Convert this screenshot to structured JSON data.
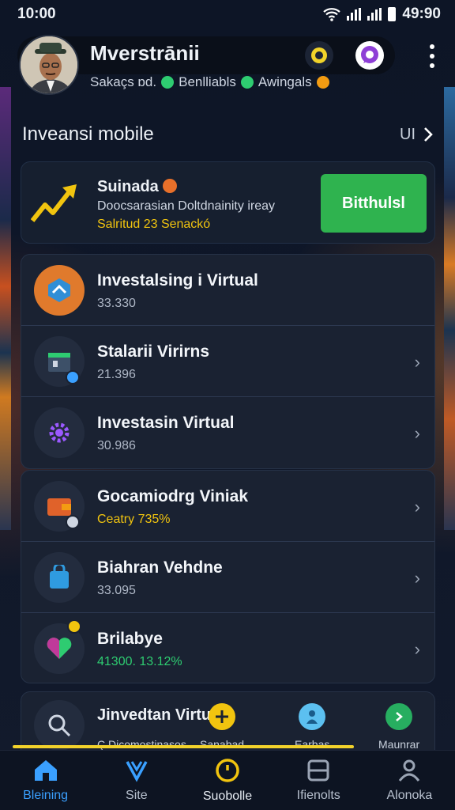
{
  "status": {
    "time": "10:00",
    "battery_time": "49:90"
  },
  "header": {
    "name": "Mverstrānii",
    "subtitle": [
      "Sakaçs ɒd.",
      "Benlliabls",
      "Awingals"
    ]
  },
  "section": {
    "title": "Inveansi mobile",
    "more": "UI"
  },
  "promo": {
    "title": "Suinada",
    "desc": "Doocsarasian Doltdnainity ireay",
    "note": "Salritud 23 Senackó",
    "button": "Bitthulsl"
  },
  "items": [
    {
      "title": "Investalsing i Virtual",
      "value": "33.330"
    },
    {
      "title": "Stalarii Virirns",
      "value": "21.396"
    },
    {
      "title": "Investasin Virtual",
      "value": "30.986"
    },
    {
      "title": "Gocamiodrg Viniak",
      "value": "Ceatry 735%"
    },
    {
      "title": "Biahran Vehdne",
      "value": "33.095"
    },
    {
      "title": "Brilabye",
      "value": "41300. 13.12%"
    }
  ],
  "partial": {
    "title": "Jinvedtan Virtu",
    "note": "Ç Dicomostinasos",
    "icons": [
      "Sanabad",
      "Earbas",
      "Maunrar"
    ]
  },
  "nav": [
    {
      "label": "Bleining"
    },
    {
      "label": "Site"
    },
    {
      "label": "Suobolle"
    },
    {
      "label": "Ifienolts"
    },
    {
      "label": "Alonoka"
    }
  ],
  "colors": {
    "accent": "#3aa0ff",
    "primary_button": "#2fb34f",
    "highlight": "#f1c40f"
  }
}
